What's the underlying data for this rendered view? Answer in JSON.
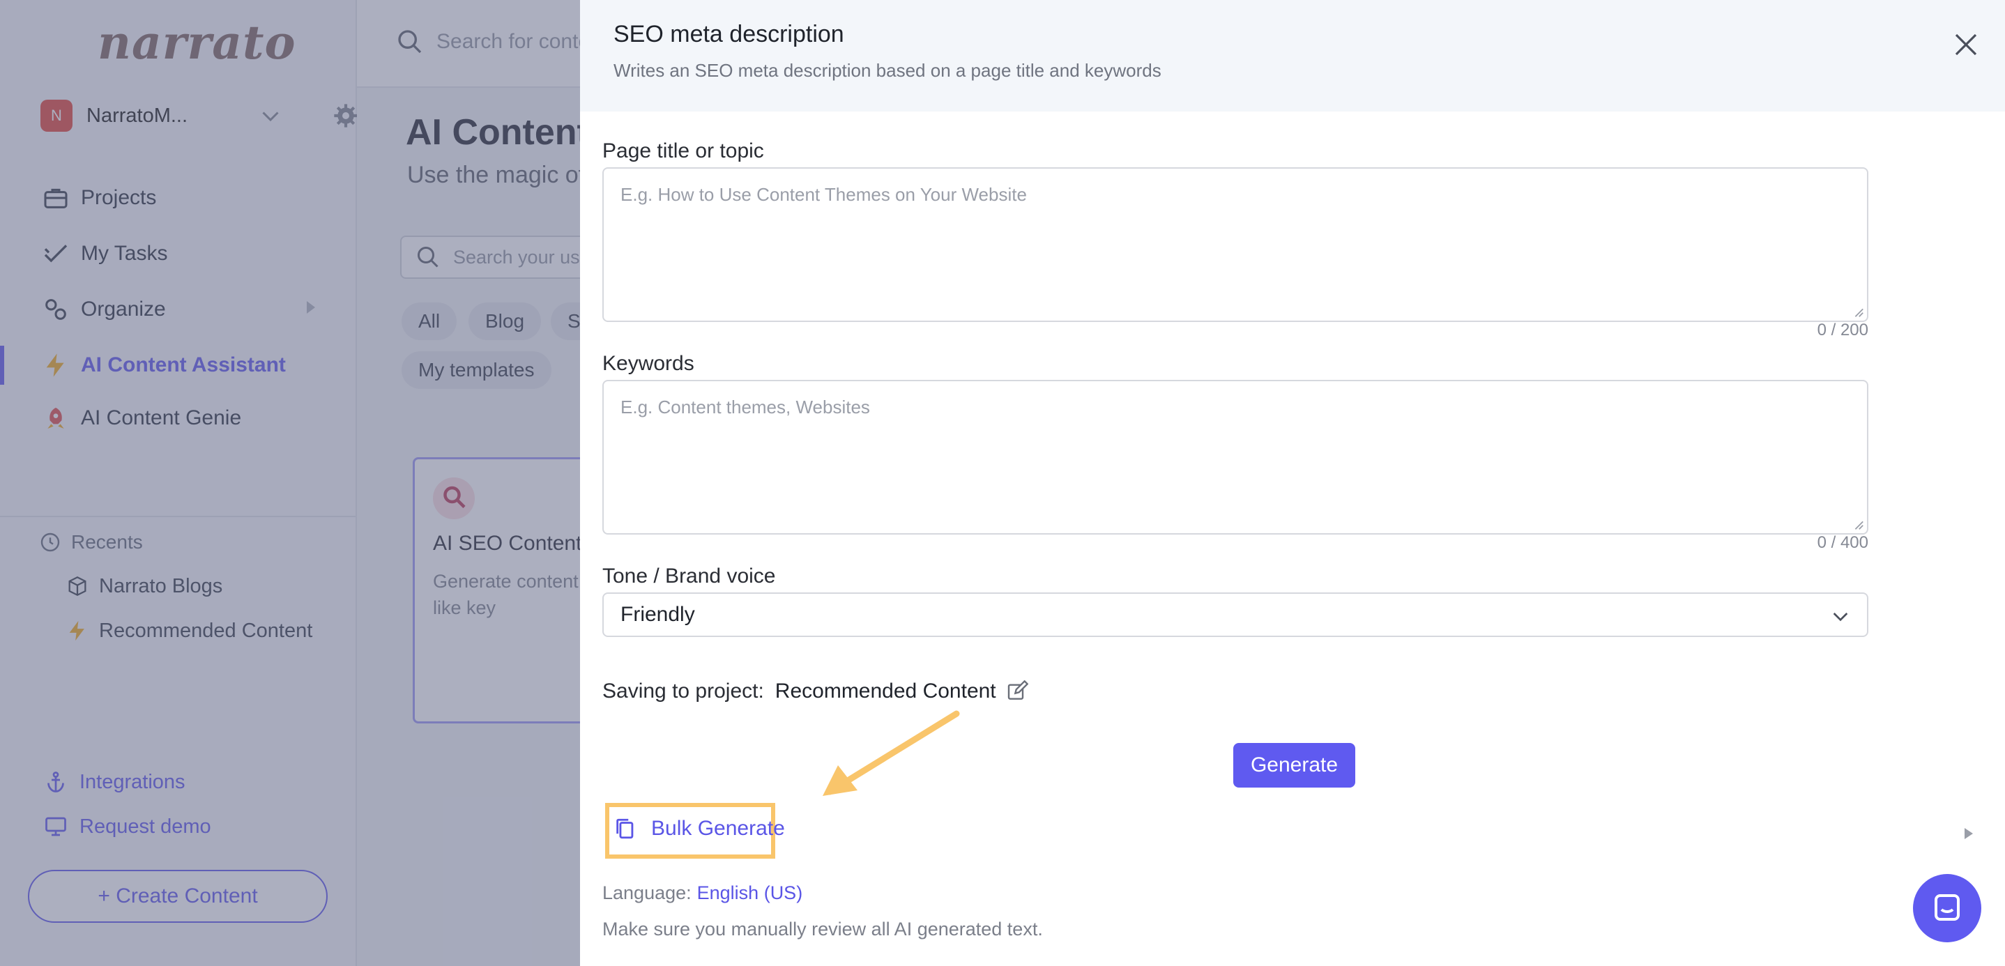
{
  "sidebar": {
    "logo": "narrato",
    "workspace": {
      "initial": "N",
      "name": "NarratoM..."
    },
    "nav": [
      {
        "label": "Projects"
      },
      {
        "label": "My Tasks"
      },
      {
        "label": "Organize"
      },
      {
        "label": "AI Content Assistant"
      },
      {
        "label": "AI Content Genie"
      }
    ],
    "recents_label": "Recents",
    "recents": [
      "Narrato Blogs",
      "Recommended Content"
    ],
    "integrations": "Integrations",
    "request_demo": "Request demo",
    "create_content": "+ Create Content"
  },
  "main": {
    "search_placeholder": "Search for conte",
    "title": "AI Content",
    "subtitle": "Use the magic of",
    "template_search_placeholder": "Search your us",
    "chips": [
      "All",
      "Blog",
      "S",
      "My templates"
    ],
    "card": {
      "title": "AI SEO Content",
      "desc": "Generate content guidelines like key"
    }
  },
  "drawer": {
    "title": "SEO meta description",
    "subtitle": "Writes an SEO meta description based on a page title and keywords",
    "fields": {
      "page_title": {
        "label": "Page title or topic",
        "placeholder": "E.g. How to Use Content Themes on Your Website",
        "counter": "0 / 200"
      },
      "keywords": {
        "label": "Keywords",
        "placeholder": "E.g. Content themes, Websites",
        "counter": "0 / 400"
      },
      "tone": {
        "label": "Tone / Brand voice",
        "value": "Friendly"
      }
    },
    "saving_label": "Saving to project:",
    "saving_project": "Recommended Content",
    "generate": "Generate",
    "bulk_generate": "Bulk Generate",
    "language_label": "Language:",
    "language_value": "English (US)",
    "review_note": "Make sure you manually review all AI generated text."
  },
  "colors": {
    "accent": "#5f5af0",
    "highlight": "#f9c56b",
    "header_bg": "#f3f6fa"
  }
}
